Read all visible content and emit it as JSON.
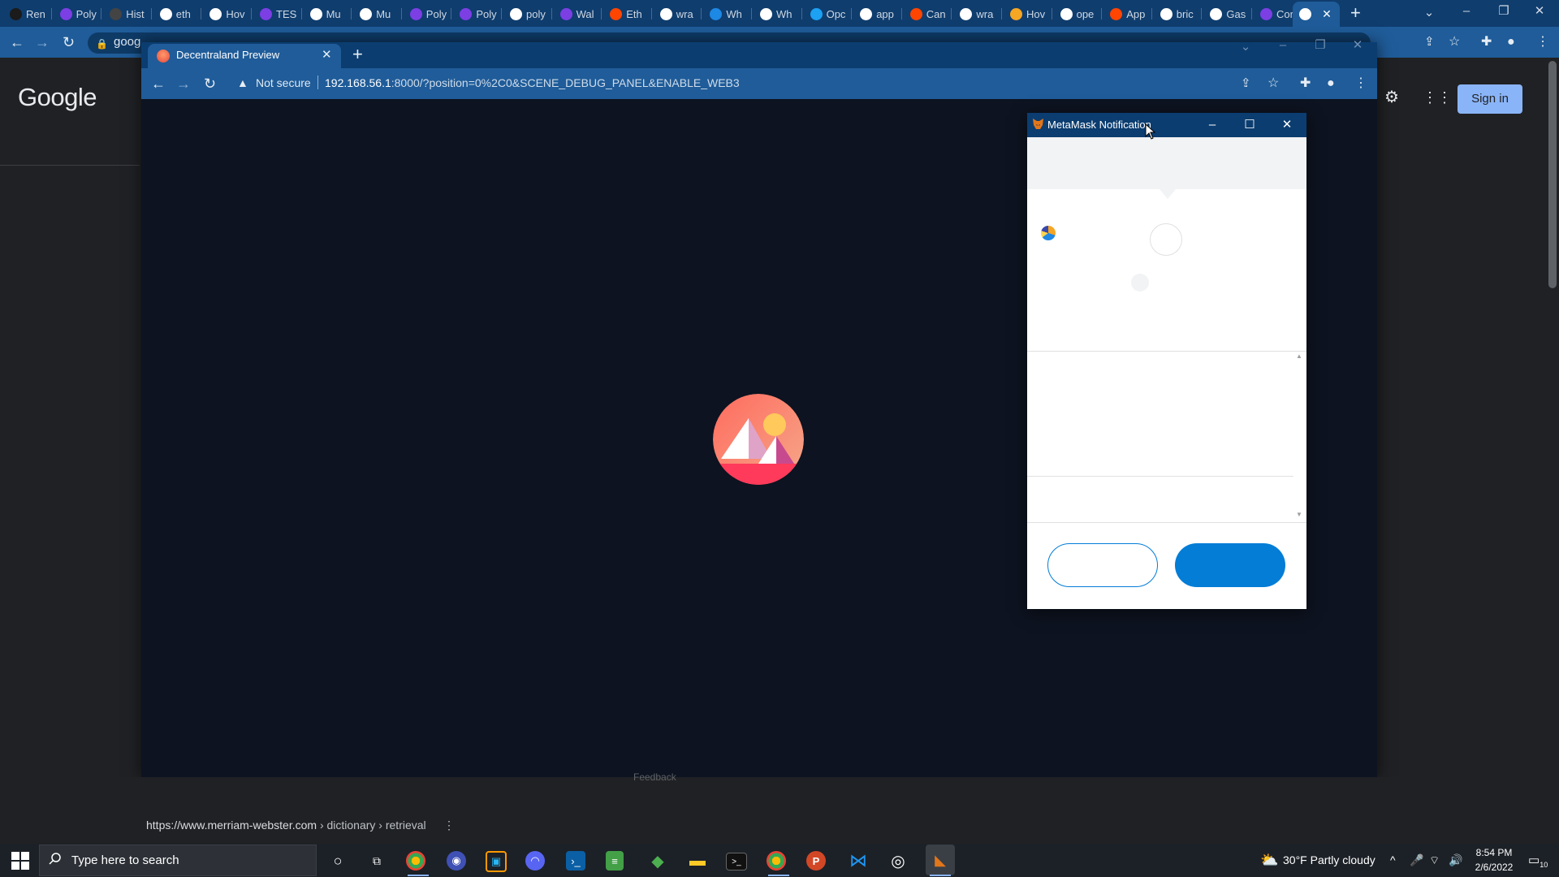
{
  "background_browser": {
    "tabs": [
      {
        "label": "Ren",
        "icon": "rarible-icon",
        "color": "#1b1b1b"
      },
      {
        "label": "Poly",
        "icon": "polygon-icon",
        "color": "#7b3fe4"
      },
      {
        "label": "Hist",
        "icon": "history-icon",
        "color": "#444444"
      },
      {
        "label": "eth",
        "icon": "google-icon",
        "color": "#ffffff"
      },
      {
        "label": "Hov",
        "icon": "zapier-icon",
        "color": "#ffffff"
      },
      {
        "label": "TES",
        "icon": "polygon-icon",
        "color": "#7b3fe4"
      },
      {
        "label": "Mu",
        "icon": "moralis-icon",
        "color": "#ffffff"
      },
      {
        "label": "Mu",
        "icon": "moralis-icon",
        "color": "#ffffff"
      },
      {
        "label": "Poly",
        "icon": "polygon-icon",
        "color": "#7b3fe4"
      },
      {
        "label": "Poly",
        "icon": "polygon-icon",
        "color": "#7b3fe4"
      },
      {
        "label": "poly",
        "icon": "google-icon",
        "color": "#ffffff"
      },
      {
        "label": "Wal",
        "icon": "polygon-icon",
        "color": "#7b3fe4"
      },
      {
        "label": "Eth",
        "icon": "reddit-icon",
        "color": "#ff4500"
      },
      {
        "label": "wra",
        "icon": "google-icon",
        "color": "#ffffff"
      },
      {
        "label": "Wh",
        "icon": "globe-blue-icon",
        "color": "#1e88e5"
      },
      {
        "label": "Wh",
        "icon": "globe-icon",
        "color": "#ffffff"
      },
      {
        "label": "Opc",
        "icon": "twitter-icon",
        "color": "#1da1f2"
      },
      {
        "label": "app",
        "icon": "google-icon",
        "color": "#ffffff"
      },
      {
        "label": "Can",
        "icon": "reddit-icon",
        "color": "#ff4500"
      },
      {
        "label": "wra",
        "icon": "google-icon",
        "color": "#ffffff"
      },
      {
        "label": "Hov",
        "icon": "coin-icon",
        "color": "#f5a623"
      },
      {
        "label": "ope",
        "icon": "google-icon",
        "color": "#ffffff"
      },
      {
        "label": "App",
        "icon": "reddit-icon",
        "color": "#ff4500"
      },
      {
        "label": "bric",
        "icon": "google-icon",
        "color": "#ffffff"
      },
      {
        "label": "Gas",
        "icon": "globe-icon",
        "color": "#ffffff"
      },
      {
        "label": "Cor",
        "icon": "polygon-icon",
        "color": "#7b3fe4"
      }
    ],
    "omnibox_text": "goog",
    "google_logo": "Google",
    "sign_in": "Sign in",
    "cite_url": "https://www.merriam-webster.com",
    "cite_path": " › dictionary › retrieval",
    "cite_menu": "⋮"
  },
  "foreground_browser": {
    "tab_title": "Decentraland Preview",
    "not_secure": "Not secure",
    "url_host": "192.168.56.1",
    "url_rest": ":8000/?position=0%2C0&SCENE_DEBUG_PANEL&ENABLE_WEB3",
    "bottom_text": "Feedback"
  },
  "metamask": {
    "title": "MetaMask Notification",
    "reject_label": "",
    "confirm_label": "",
    "accent": "#037dd6"
  },
  "taskbar": {
    "search_placeholder": "Type here to search",
    "weather": "30°F  Partly cloudy",
    "time": "8:54 PM",
    "date": "2/6/2022",
    "notification_count": "10"
  }
}
